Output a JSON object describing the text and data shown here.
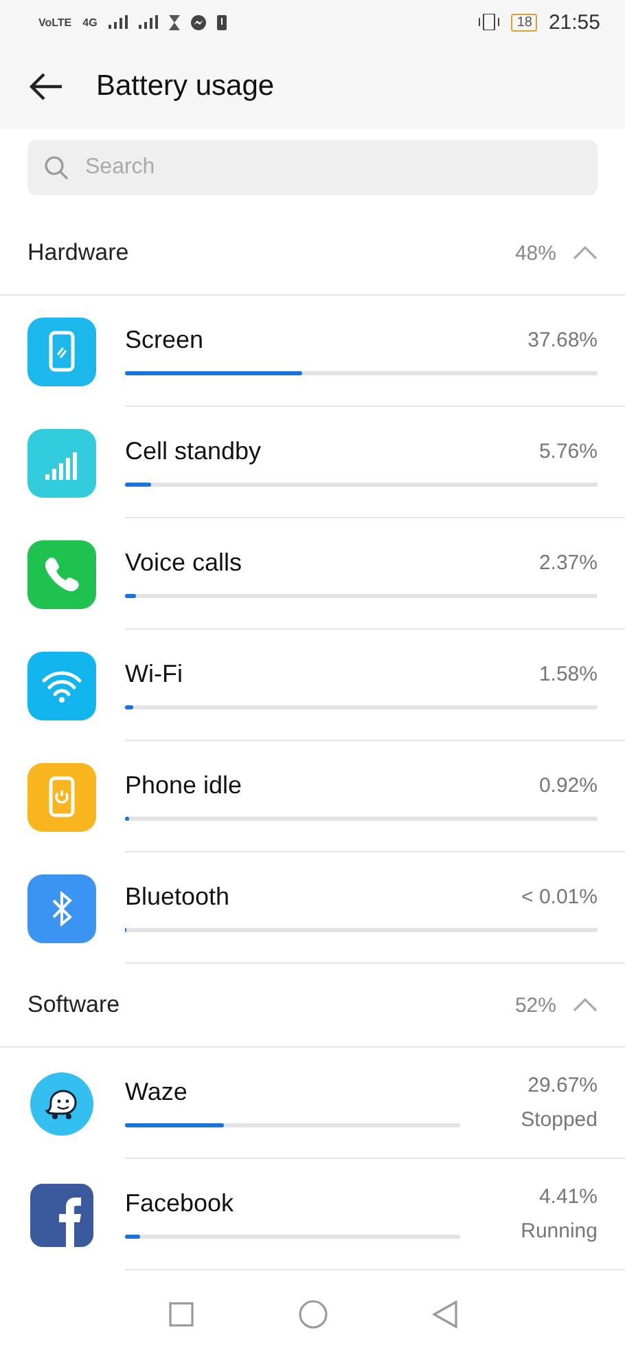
{
  "status_bar": {
    "left": [
      "VoLTE",
      "4G"
    ],
    "battery": "18",
    "time": "21:55"
  },
  "header": {
    "title": "Battery usage"
  },
  "search": {
    "placeholder": "Search"
  },
  "sections": [
    {
      "title": "Hardware",
      "total": "48%",
      "expanded": true,
      "items": [
        {
          "name": "Screen",
          "value": "37.68%",
          "level": 0.375
        },
        {
          "name": "Cell standby",
          "value": "5.76%",
          "level": 0.056
        },
        {
          "name": "Voice calls",
          "value": "2.37%",
          "level": 0.024
        },
        {
          "name": "Wi-Fi",
          "value": "1.58%",
          "level": 0.016
        },
        {
          "name": "Phone idle",
          "value": "0.92%",
          "level": 0.01
        },
        {
          "name": "Bluetooth",
          "value": "< 0.01%",
          "level": 0.003
        }
      ]
    },
    {
      "title": "Software",
      "total": "52%",
      "expanded": true,
      "items": [
        {
          "name": "Waze",
          "value": "29.67%",
          "status": "Stopped",
          "level": 0.297
        },
        {
          "name": "Facebook",
          "value": "4.41%",
          "status": "Running",
          "level": 0.044
        }
      ]
    }
  ]
}
